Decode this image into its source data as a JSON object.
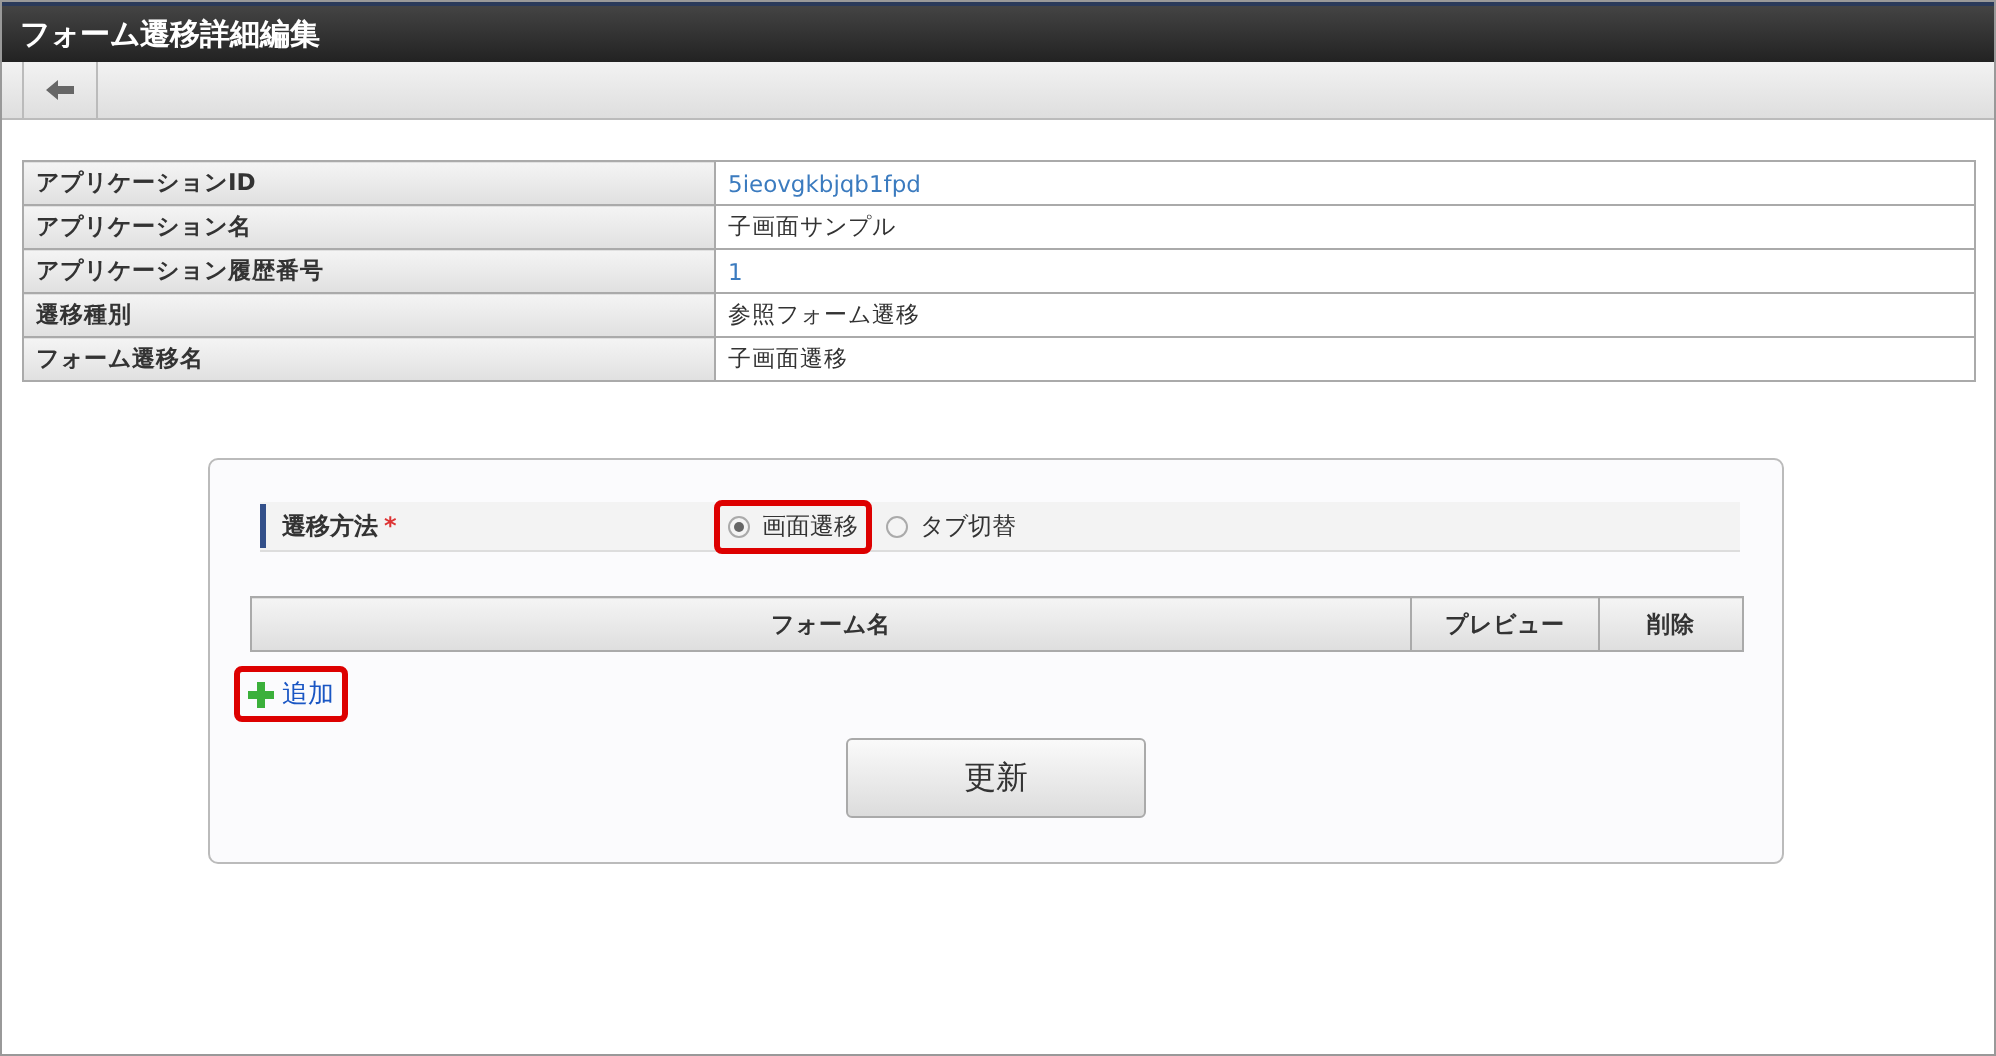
{
  "window": {
    "title": "フォーム遷移詳細編集"
  },
  "toolbar": {
    "back_button": true
  },
  "info_table": [
    {
      "label": "アプリケーションID",
      "value": "5ieovgkbjqb1fpd",
      "kind": "link"
    },
    {
      "label": "アプリケーション名",
      "value": "子画面サンプル",
      "kind": "text"
    },
    {
      "label": "アプリケーション履歴番号",
      "value": "1",
      "kind": "link"
    },
    {
      "label": "遷移種別",
      "value": "参照フォーム遷移",
      "kind": "text"
    },
    {
      "label": "フォーム遷移名",
      "value": "子画面遷移",
      "kind": "text"
    }
  ],
  "method": {
    "label": "遷移方法",
    "required_mark": "*",
    "options": [
      {
        "label": "画面遷移",
        "selected": true,
        "highlighted": true
      },
      {
        "label": "タブ切替",
        "selected": false,
        "highlighted": false
      }
    ]
  },
  "form_table": {
    "columns": [
      "フォーム名",
      "プレビュー",
      "削除"
    ]
  },
  "add_link": {
    "label": "追加",
    "highlighted": true
  },
  "update_button": "更新"
}
